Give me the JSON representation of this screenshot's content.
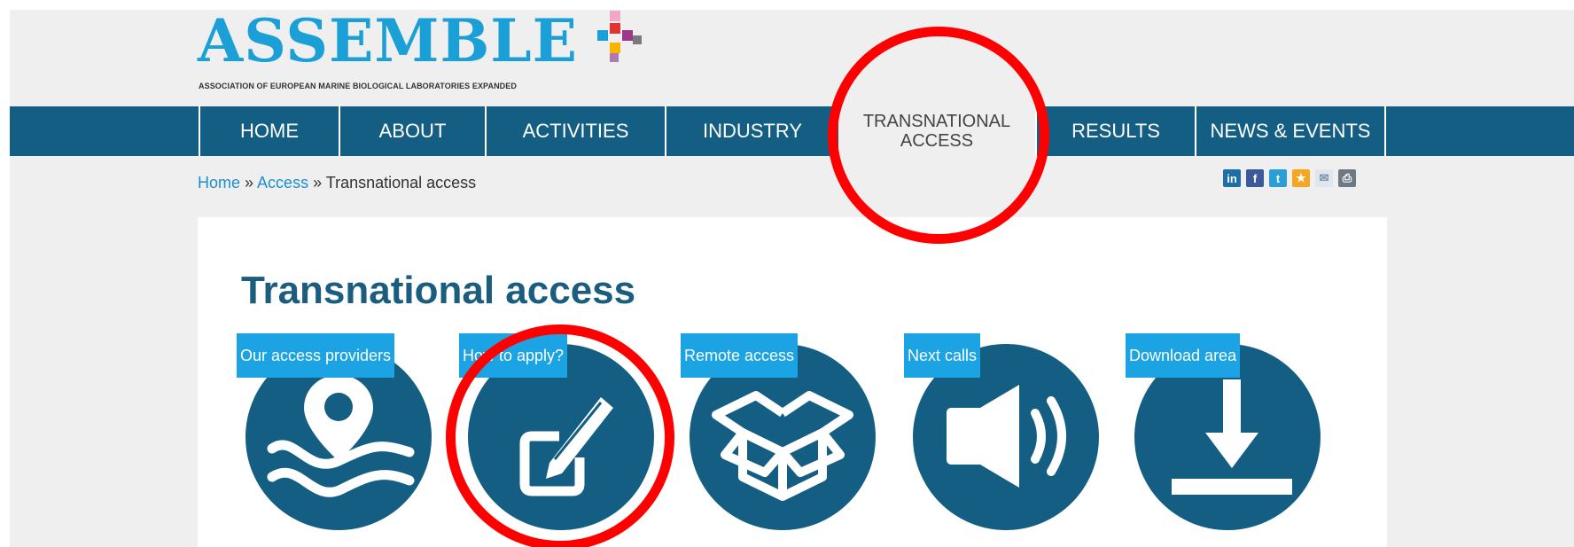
{
  "logo": {
    "wordmark": "ASSEMBLE",
    "tagline": "ASSOCIATION OF EUROPEAN MARINE BIOLOGICAL LABORATORIES EXPANDED"
  },
  "nav": {
    "items": [
      {
        "label": "HOME"
      },
      {
        "label": "ABOUT"
      },
      {
        "label": "ACTIVITIES"
      },
      {
        "label": "INDUSTRY"
      },
      {
        "label": "TRANSNATIONAL\nACCESS"
      },
      {
        "label": "RESULTS"
      },
      {
        "label": "NEWS & EVENTS"
      }
    ],
    "active": "TRANSNATIONAL ACCESS"
  },
  "breadcrumb": {
    "home": "Home",
    "sep1": " » ",
    "access": "Access",
    "sep2": " » ",
    "current": "Transnational access"
  },
  "share": {
    "linkedin": "in",
    "facebook": "f",
    "twitter": "t",
    "favorite": "★",
    "email": "✉",
    "print": "⎙"
  },
  "page": {
    "title": "Transnational access"
  },
  "tiles": [
    {
      "label": "Our access providers",
      "icon": "map-pin-waves-icon"
    },
    {
      "label": "How to apply?",
      "icon": "edit-icon"
    },
    {
      "label": "Remote access",
      "icon": "open-box-icon"
    },
    {
      "label": "Next calls",
      "icon": "megaphone-icon"
    },
    {
      "label": "Download area",
      "icon": "download-icon"
    }
  ],
  "colors": {
    "brand_blue": "#1aa0d6",
    "nav_blue": "#135e82",
    "tile_label_blue": "#1ba3e4",
    "annotation_red": "#ff0000"
  }
}
